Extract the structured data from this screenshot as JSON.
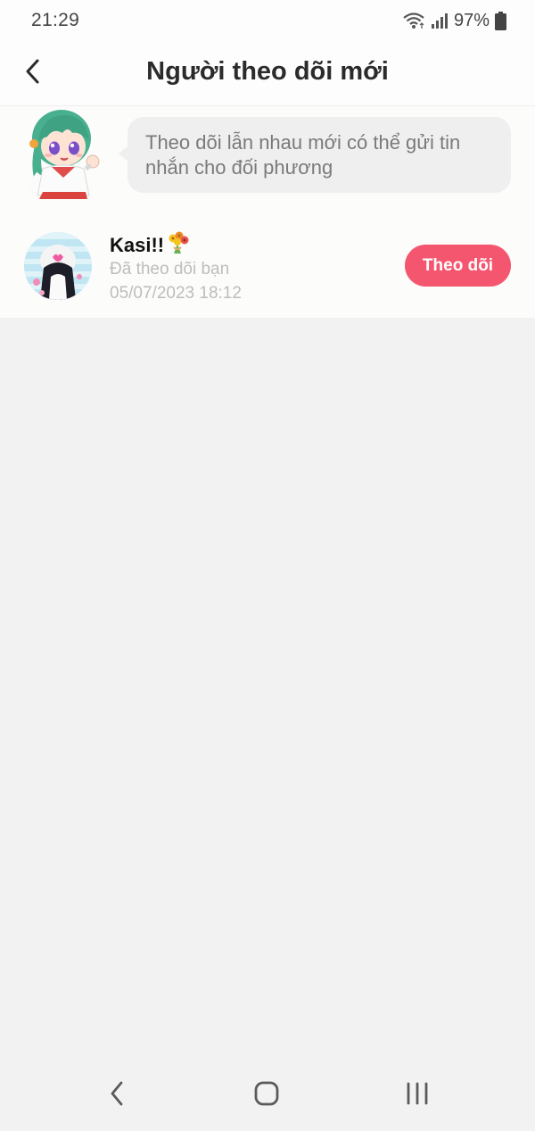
{
  "status_bar": {
    "time": "21:29",
    "battery": "97%",
    "icons": [
      "wifi-icon",
      "signal-icon",
      "battery-icon"
    ]
  },
  "header": {
    "title": "Người theo dõi mới",
    "back_icon": "chevron-left-icon"
  },
  "tip": {
    "text": "Theo dõi lẫn nhau mới có thể gửi tin nhắn cho đối phương"
  },
  "followers": [
    {
      "name": "Kasi!!",
      "emoji": "💐",
      "status": "Đã theo dõi bạn",
      "time": "05/07/2023 18:12",
      "button": "Theo dõi"
    }
  ],
  "nav": {
    "icons": [
      "nav-back-icon",
      "nav-home-icon",
      "nav-recents-icon"
    ]
  },
  "colors": {
    "accent": "#f5566f",
    "background": "#f2f2f2",
    "bubble": "#efefef",
    "muted_text": "#bdbdbd"
  }
}
